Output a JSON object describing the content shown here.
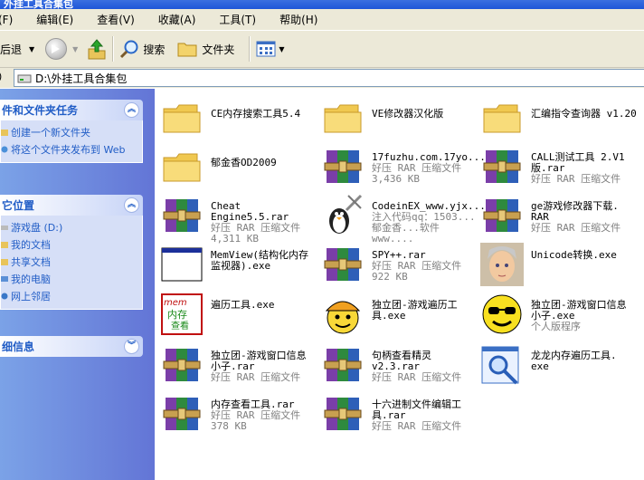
{
  "window": {
    "title": "外挂工具合集包"
  },
  "menu": {
    "items": [
      "(F)",
      "编辑(E)",
      "查看(V)",
      "收藏(A)",
      "工具(T)",
      "帮助(H)"
    ]
  },
  "toolbar": {
    "back_label": "后退",
    "search_label": "搜索",
    "folders_label": "文件夹"
  },
  "address": {
    "path": "D:\\外挂工具合集包"
  },
  "sidebar": {
    "tasks": {
      "header": "件和文件夹任务",
      "items": [
        "创建一个新文件夹",
        "将这个文件夹发布到 Web"
      ]
    },
    "places": {
      "header": "它位置",
      "items": [
        "游戏盘 (D:)",
        "我的文档",
        "共享文档",
        "我的电脑",
        "网上邻居"
      ]
    },
    "details": {
      "header": "细信息"
    }
  },
  "files": [
    {
      "name": "CE内存搜索工具5.4",
      "type": "",
      "size": "",
      "icon": "folder-icon"
    },
    {
      "name": "VE修改器汉化版",
      "type": "",
      "size": "",
      "icon": "folder-icon"
    },
    {
      "name": "汇编指令查询器 v1.20",
      "type": "",
      "size": "",
      "icon": "folder-icon"
    },
    {
      "name": "郁金香OD2009",
      "type": "",
      "size": "",
      "icon": "folder-icon"
    },
    {
      "name": "17fuzhu.com.17yo...",
      "type": "好压 RAR 压缩文件",
      "size": "3,436 KB",
      "icon": "rar-archive-icon"
    },
    {
      "name": "CALL测试工具 2.V1 版.rar",
      "type": "好压 RAR 压缩文件",
      "size": "",
      "icon": "rar-archive-icon"
    },
    {
      "name": "Cheat Engine5.5.rar",
      "type": "好压 RAR 压缩文件",
      "size": "4,311 KB",
      "icon": "rar-archive-icon"
    },
    {
      "name": "CodeinEX_www.yjx...",
      "type": "注入代码qq：1503...",
      "size": "郁金香...软件www....",
      "icon": "penguin-tool-icon"
    },
    {
      "name": "ge游戏修改器下载. RAR",
      "type": "好压 RAR 压缩文件",
      "size": "",
      "icon": "rar-archive-icon"
    },
    {
      "name": "MemView(结构化内存 监视器).exe",
      "type": "",
      "size": "",
      "icon": "window-exe-icon"
    },
    {
      "name": "SPY++.rar",
      "type": "好压 RAR 压缩文件",
      "size": "922 KB",
      "icon": "rar-archive-icon"
    },
    {
      "name": "Unicode转换.exe",
      "type": "",
      "size": "",
      "icon": "face-portrait-icon"
    },
    {
      "name": "遍历工具.exe",
      "type": "",
      "size": "",
      "icon": "mem-view-icon"
    },
    {
      "name": "独立团-游戏遍历工 具.exe",
      "type": "",
      "size": "",
      "icon": "worker-smiley-icon"
    },
    {
      "name": "独立团-游戏窗口信息 小子.exe",
      "type": "个人版程序",
      "size": "",
      "icon": "sunglasses-smiley-icon"
    },
    {
      "name": "独立团-游戏窗口信息 小子.rar",
      "type": "好压 RAR 压缩文件",
      "size": "",
      "icon": "rar-archive-icon"
    },
    {
      "name": "句柄查看精灵 v2.3.rar",
      "type": "好压 RAR 压缩文件",
      "size": "",
      "icon": "rar-archive-icon"
    },
    {
      "name": "龙龙内存遍历工具. exe",
      "type": "",
      "size": "",
      "icon": "magnifier-window-icon"
    },
    {
      "name": "内存查看工具.rar",
      "type": "好压 RAR 压缩文件",
      "size": "378 KB",
      "icon": "rar-archive-icon"
    },
    {
      "name": "十六进制文件编辑工 具.rar",
      "type": "好压 RAR 压缩文件",
      "size": "",
      "icon": "rar-archive-icon"
    }
  ],
  "colors": {
    "taskpane_link": "#215dc6",
    "taskpane_bg": "#d6dff7",
    "chrome": "#ece9d8"
  }
}
